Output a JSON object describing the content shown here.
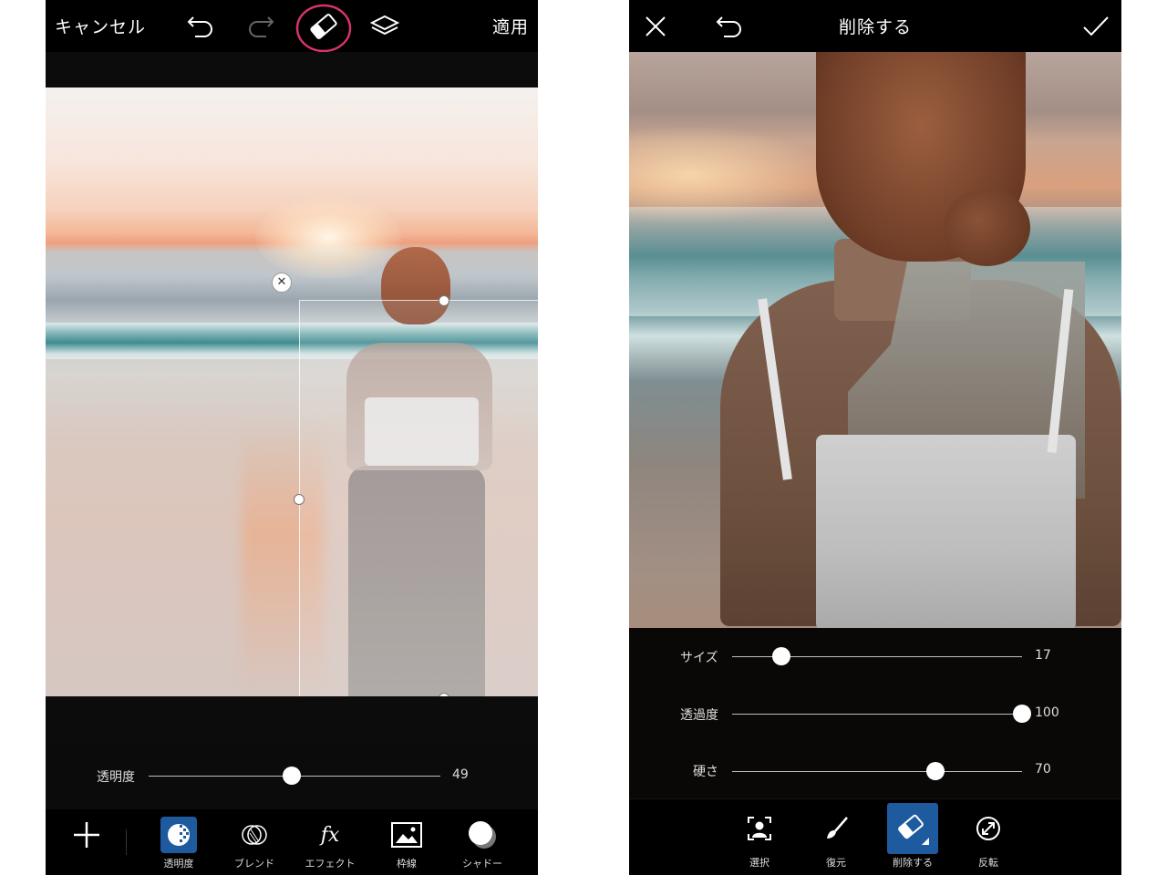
{
  "left_screen": {
    "topbar": {
      "cancel_label": "キャンセル",
      "apply_label": "適用"
    },
    "slider": {
      "label": "透明度",
      "value": "49",
      "level": 0.49
    },
    "tools": [
      {
        "label": "透明度",
        "icon": "opacity-icon",
        "active": true
      },
      {
        "label": "ブレンド",
        "icon": "blend-icon",
        "active": false
      },
      {
        "label": "エフェクト",
        "icon": "fx-icon",
        "active": false
      },
      {
        "label": "枠線",
        "icon": "border-icon",
        "active": false
      },
      {
        "label": "シャドー",
        "icon": "shadow-icon",
        "active": false
      }
    ],
    "add_icon": "plus-icon",
    "highlight_color": "#d6336c"
  },
  "right_screen": {
    "topbar": {
      "title": "削除する"
    },
    "sliders": [
      {
        "label": "サイズ",
        "value": "17",
        "level": 0.17
      },
      {
        "label": "透過度",
        "value": "100",
        "level": 1.0
      },
      {
        "label": "硬さ",
        "value": "70",
        "level": 0.7
      }
    ],
    "tools": [
      {
        "label": "選択",
        "icon": "select-person-icon",
        "active": false
      },
      {
        "label": "復元",
        "icon": "brush-icon",
        "active": false
      },
      {
        "label": "削除する",
        "icon": "eraser-icon",
        "active": true
      },
      {
        "label": "反転",
        "icon": "invert-icon",
        "active": false
      }
    ],
    "accent_color": "#1e5a9e"
  }
}
